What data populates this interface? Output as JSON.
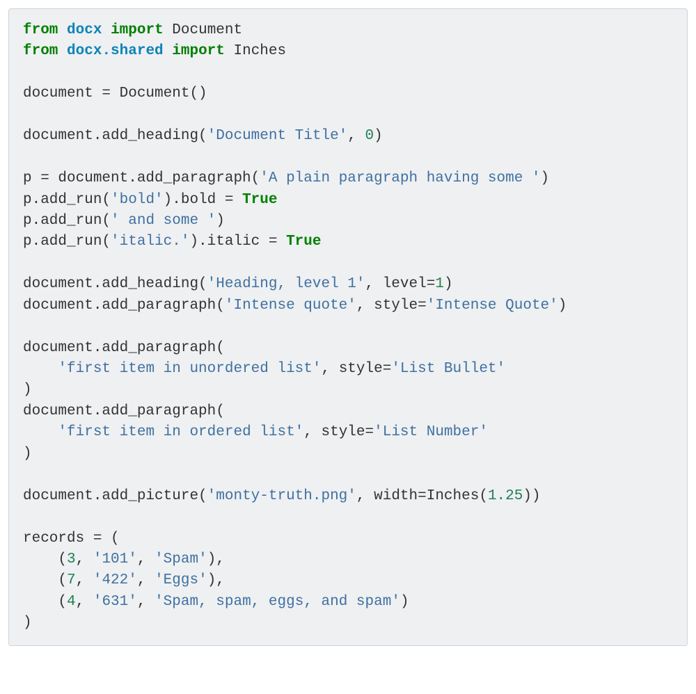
{
  "tokens": {
    "kw_from": "from",
    "kw_import": "import",
    "mod_docx": "docx",
    "mod_docx_shared": "docx.shared",
    "name_Document": "Document",
    "name_Inches": "Inches",
    "str_doc_title": "'Document Title'",
    "num_0": "0",
    "str_plain_para": "'A plain paragraph having some '",
    "str_bold": "'bold'",
    "str_and_some": "' and some '",
    "str_italic": "'italic.'",
    "const_True": "True",
    "str_heading1": "'Heading, level 1'",
    "num_1": "1",
    "str_intense_quote": "'Intense quote'",
    "str_intense_quote_style": "'Intense Quote'",
    "str_unordered": "'first item in unordered list'",
    "str_list_bullet": "'List Bullet'",
    "str_ordered": "'first item in ordered list'",
    "str_list_number": "'List Number'",
    "str_monty": "'monty-truth.png'",
    "num_1_25": "1.25",
    "num_3": "3",
    "str_101": "'101'",
    "str_spam": "'Spam'",
    "num_7": "7",
    "str_422": "'422'",
    "str_eggs": "'Eggs'",
    "num_4": "4",
    "str_631": "'631'",
    "str_spam_long": "'Spam, spam, eggs, and spam'"
  },
  "plain": {
    "l3": "document = Document()",
    "l5_a": "document.add_heading(",
    "l5_b": ", ",
    "l5_c": ")",
    "l7_a": "p = document.add_paragraph(",
    "l7_b": ")",
    "l8_a": "p.add_run(",
    "l8_b": ").bold = ",
    "l9_a": "p.add_run(",
    "l9_b": ")",
    "l10_a": "p.add_run(",
    "l10_b": ").italic = ",
    "l12_a": "document.add_heading(",
    "l12_b": ", level=",
    "l12_c": ")",
    "l13_a": "document.add_paragraph(",
    "l13_b": ", style=",
    "l13_c": ")",
    "l15": "document.add_paragraph(",
    "l16_a": "    ",
    "l16_b": ", style=",
    "l17": ")",
    "l18": "document.add_paragraph(",
    "l19_a": "    ",
    "l19_b": ", style=",
    "l20": ")",
    "l22_a": "document.add_picture(",
    "l22_b": ", width=Inches(",
    "l22_c": "))",
    "l24": "records = (",
    "l25_a": "    (",
    "l25_b": ", ",
    "l25_c": ", ",
    "l25_d": "),",
    "l26_a": "    (",
    "l26_b": ", ",
    "l26_c": ", ",
    "l26_d": "),",
    "l27_a": "    (",
    "l27_b": ", ",
    "l27_c": ", ",
    "l27_d": ")",
    "l28": ")"
  }
}
